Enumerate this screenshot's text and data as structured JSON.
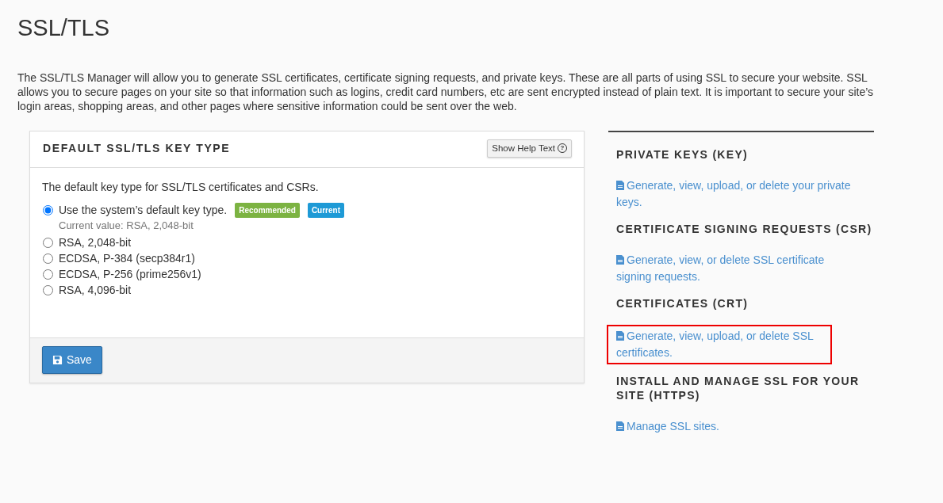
{
  "title": "SSL/TLS",
  "intro": "The SSL/TLS Manager will allow you to generate SSL certificates, certificate signing requests, and private keys. These are all parts of using SSL to secure your website. SSL allows you to secure pages on your site so that information such as logins, credit card numbers, etc are sent encrypted instead of plain text. It is important to secure your site’s login areas, shopping areas, and other pages where sensitive information could be sent over the web.",
  "panel": {
    "heading": "DEFAULT SSL/TLS KEY TYPE",
    "help_button": "Show Help Text",
    "help_icon": "?",
    "description": "The default key type for SSL/TLS certificates and CSRs.",
    "options": [
      {
        "label": "Use the system’s default key type.",
        "selected": true,
        "badges": [
          {
            "text": "Recommended",
            "color": "#7cb342"
          },
          {
            "text": "Current",
            "color": "#1e9ad6"
          }
        ],
        "note": "Current value: RSA, 2,048-bit"
      },
      {
        "label": "RSA, 2,048-bit",
        "selected": false
      },
      {
        "label": "ECDSA, P-384 (secp384r1)",
        "selected": false
      },
      {
        "label": "ECDSA, P-256 (prime256v1)",
        "selected": false
      },
      {
        "label": "RSA, 4,096-bit",
        "selected": false
      }
    ],
    "save_button": "Save"
  },
  "sections": [
    {
      "heading": "PRIVATE KEYS (KEY)",
      "link": "Generate, view, upload, or delete your private keys.",
      "highlighted": false
    },
    {
      "heading": "CERTIFICATE SIGNING REQUESTS (CSR)",
      "link": "Generate, view, or delete SSL certificate signing requests.",
      "highlighted": false
    },
    {
      "heading": "CERTIFICATES (CRT)",
      "link": "Generate, view, upload, or delete SSL certificates.",
      "highlighted": true
    },
    {
      "heading": "INSTALL AND MANAGE SSL FOR YOUR SITE (HTTPS)",
      "link": "Manage SSL sites.",
      "highlighted": false
    }
  ]
}
